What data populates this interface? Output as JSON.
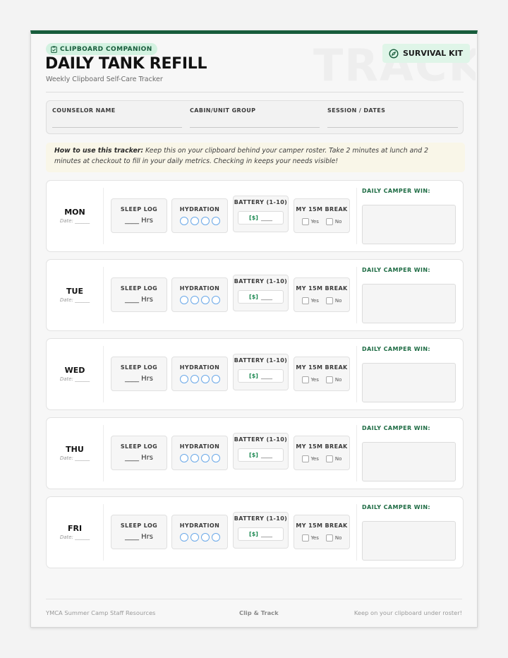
{
  "header": {
    "badge": "CLIPBOARD COMPANION",
    "title": "DAILY TANK REFILL",
    "subtitle": "Weekly Clipboard Self-Care Tracker",
    "kit_label": "SURVIVAL KIT",
    "watermark": "TRACK"
  },
  "info": {
    "fields": [
      {
        "label": "COUNSELOR NAME"
      },
      {
        "label": "CABIN/UNIT GROUP"
      },
      {
        "label": "SESSION / DATES"
      }
    ]
  },
  "howto": {
    "lead": "How to use this tracker:",
    "text": " Keep this on your clipboard behind your camper roster. Take 2 minutes at lunch and 2 minutes at checkout to fill in your daily metrics. Checking in keeps your needs visible!"
  },
  "labels": {
    "date": "Date: ______",
    "sleep": "SLEEP LOG",
    "sleep_value": "____ Hrs",
    "hydration": "HYDRATION",
    "battery": "BATTERY (1-10)",
    "battery_icon": "[$]",
    "battery_blank": "____",
    "break": "MY 15M BREAK",
    "yes": "Yes",
    "no": "No",
    "win": "DAILY CAMPER WIN:"
  },
  "days": [
    {
      "name": "MON"
    },
    {
      "name": "TUE"
    },
    {
      "name": "WED"
    },
    {
      "name": "THU"
    },
    {
      "name": "FRI"
    }
  ],
  "footer": {
    "left": "YMCA Summer Camp Staff Resources",
    "middle": "Clip & Track",
    "right": "Keep on your clipboard under roster!"
  },
  "colors": {
    "brand_green": "#175c3b",
    "accent_mint": "#d3f2e1",
    "hydration_blue": "#6aa8e8"
  }
}
